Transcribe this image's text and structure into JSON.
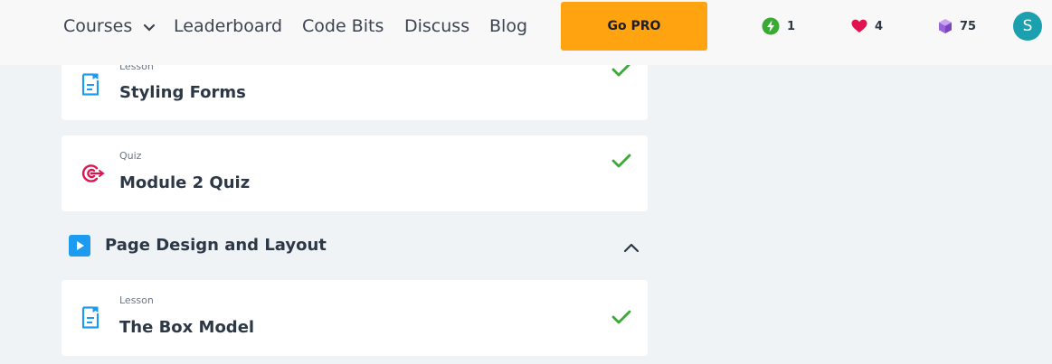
{
  "nav": {
    "courses": "Courses",
    "leaderboard": "Leaderboard",
    "code_bits": "Code Bits",
    "discuss": "Discuss",
    "blog": "Blog",
    "go_pro": "Go PRO"
  },
  "stats": {
    "streak": "1",
    "hearts": "4",
    "bits": "75"
  },
  "user": {
    "avatar_letter": "S"
  },
  "items": [
    {
      "kind": "Lesson",
      "title": "Styling Forms",
      "completed": true,
      "icon": "lesson-icon"
    },
    {
      "kind": "Quiz",
      "title": "Module 2 Quiz",
      "completed": true,
      "icon": "quiz-target-icon"
    },
    {
      "kind": "Lesson",
      "title": "The Box Model",
      "completed": true,
      "icon": "lesson-icon"
    }
  ],
  "module": {
    "title": "Page Design and Layout",
    "expanded": true
  },
  "colors": {
    "accent_orange": "#ffa310",
    "check_green": "#3aaa35",
    "lesson_blue": "#1d9bf0",
    "quiz_red": "#e0134f",
    "avatar_teal": "#1ca0b0"
  }
}
